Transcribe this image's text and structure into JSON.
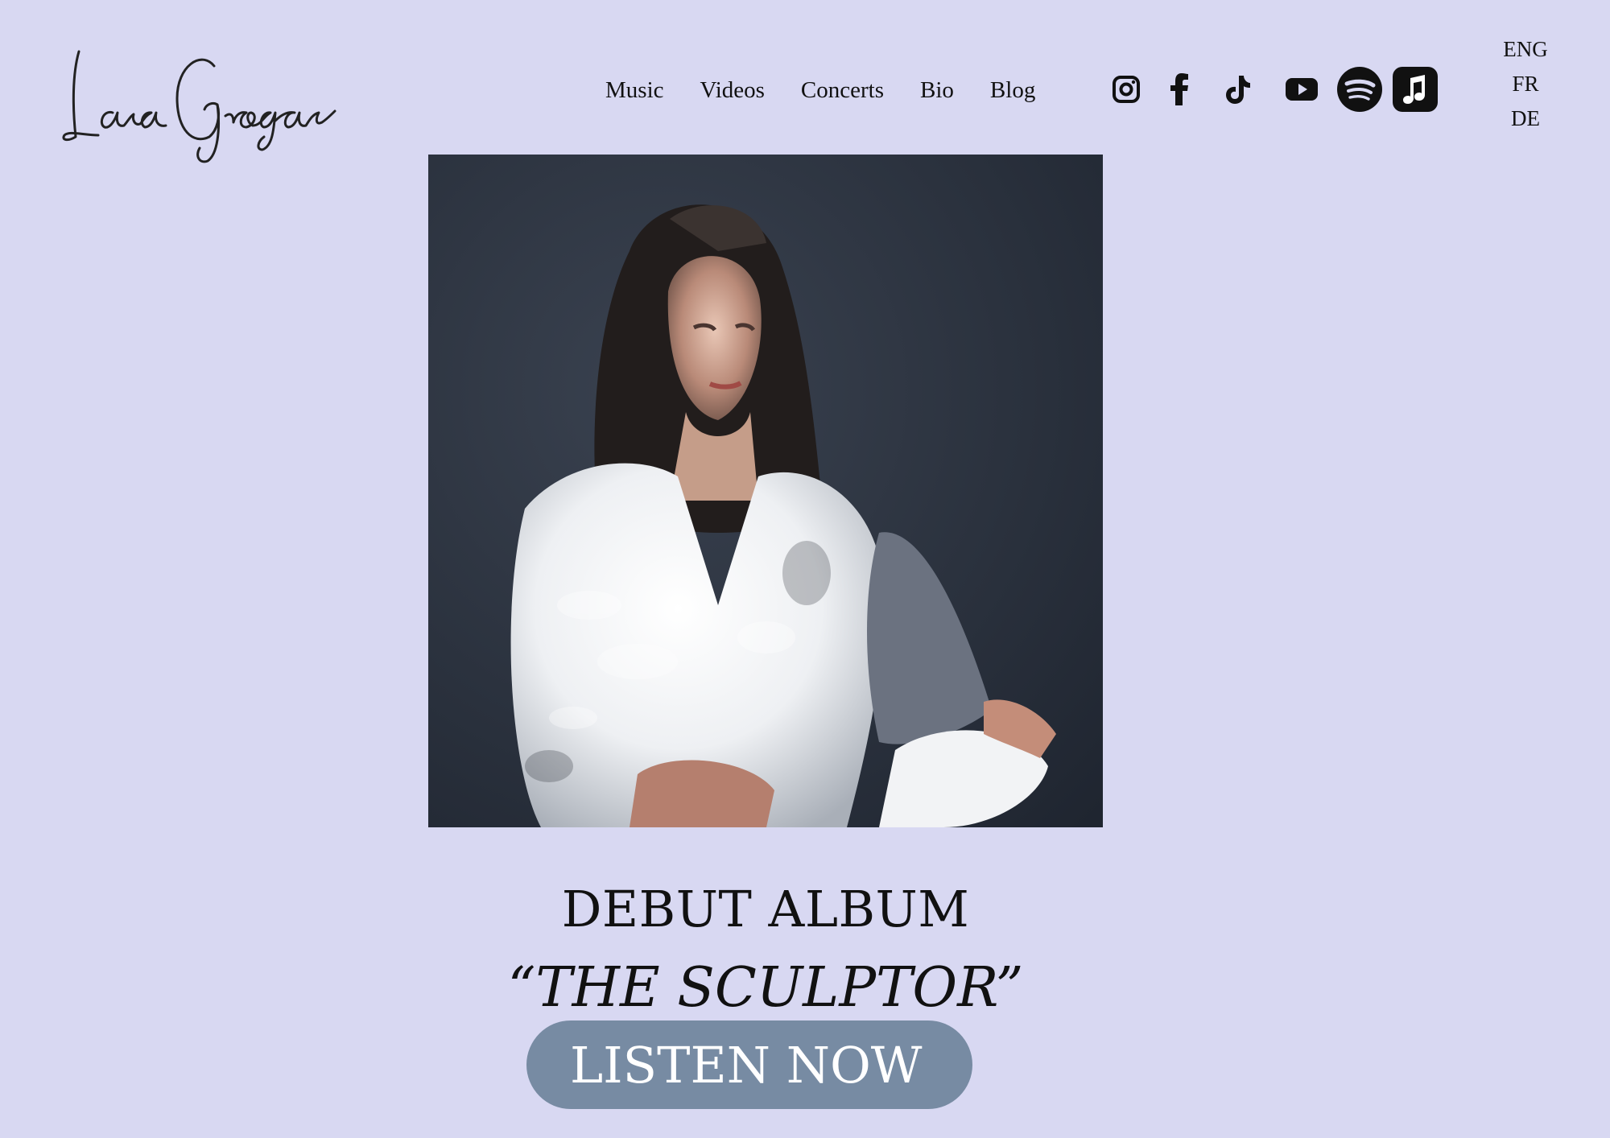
{
  "brand": {
    "name": "Lara Grogan"
  },
  "nav": {
    "items": [
      {
        "label": "Music"
      },
      {
        "label": "Videos"
      },
      {
        "label": "Concerts"
      },
      {
        "label": "Bio"
      },
      {
        "label": "Blog"
      }
    ]
  },
  "socials": [
    {
      "icon": "instagram-icon"
    },
    {
      "icon": "facebook-icon"
    },
    {
      "icon": "tiktok-icon"
    },
    {
      "icon": "youtube-icon"
    },
    {
      "icon": "spotify-icon"
    },
    {
      "icon": "apple-music-icon"
    }
  ],
  "languages": [
    "ENG",
    "FR",
    "DE"
  ],
  "hero": {
    "artwork_icon": "album-cover-painting",
    "heading": "DEBUT ALBUM",
    "album_title": "“THE SCULPTOR”",
    "cta_label": "LISTEN NOW"
  },
  "colors": {
    "background": "#d8d8f2",
    "cta_background": "#778ba3",
    "text": "#111111"
  }
}
